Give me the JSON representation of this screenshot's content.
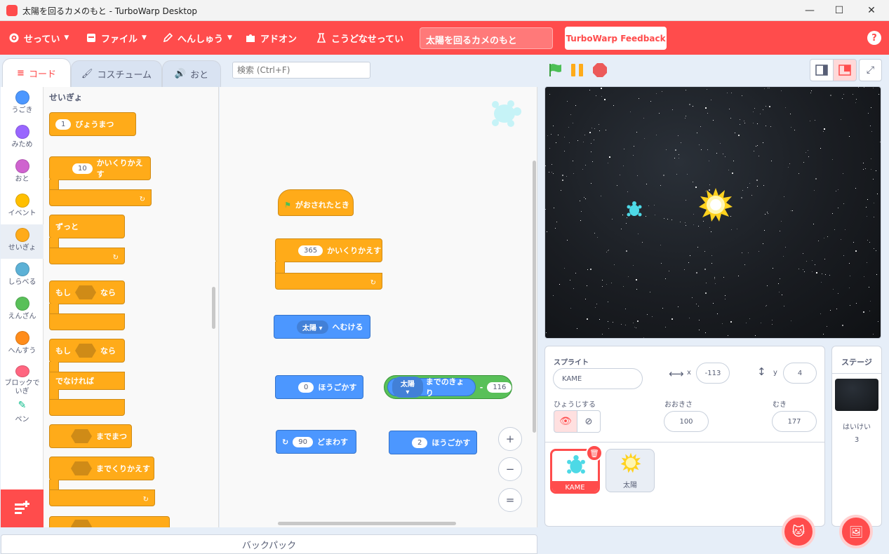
{
  "window": {
    "title": "太陽を回るカメのもと - TurboWarp Desktop",
    "minimize": "—",
    "maximize": "☐",
    "close": "✕"
  },
  "menu": {
    "settings": "せってい",
    "file": "ファイル",
    "edit": "へんしゅう",
    "addons": "アドオン",
    "howto": "こうどなせってい",
    "project_title": "太陽を回るカメのもと",
    "feedback": "TurboWarp Feedback",
    "help": "?"
  },
  "tabs": {
    "code": "コード",
    "costume": "コスチューム",
    "sound": "おと"
  },
  "search": {
    "placeholder": "検索 (Ctrl+F)"
  },
  "categories": [
    {
      "label": "うごき",
      "color": "#4c97ff"
    },
    {
      "label": "みため",
      "color": "#9966ff"
    },
    {
      "label": "おと",
      "color": "#cf63cf"
    },
    {
      "label": "イベント",
      "color": "#ffbf00"
    },
    {
      "label": "せいぎょ",
      "color": "#ffab19"
    },
    {
      "label": "しらべる",
      "color": "#5cb1d6"
    },
    {
      "label": "えんざん",
      "color": "#59c059"
    },
    {
      "label": "へんすう",
      "color": "#ff8c1a"
    },
    {
      "label": "ブロックでいぎ",
      "color": "#ff6680"
    },
    {
      "label": "ペン",
      "color": ""
    }
  ],
  "flyout": {
    "heading": "せいぎょ",
    "wait_value": "1",
    "wait_label": "びょうまつ",
    "repeat_value": "10",
    "repeat_label": "かいくりかえす",
    "forever_label": "ずっと",
    "if_label": "もし",
    "then_label": "なら",
    "if2_label": "もし",
    "then2_label": "なら",
    "else_label": "でなければ",
    "wait_until_label": "までまつ",
    "repeat_until_label": "までくりかえす"
  },
  "script": {
    "hat_label": "がおされたとき",
    "repeat_value": "365",
    "repeat_label": "かいくりかえす",
    "point_target": "太陽",
    "point_label": "へむける",
    "move_value": "0",
    "move_label": "ほうごかす",
    "distance_target": "太陽",
    "distance_label": "までのきょり",
    "minus": "-",
    "minus_value": "116",
    "turn_value": "90",
    "turn_label": "どまわす",
    "move2_value": "2",
    "move2_label": "ほうごかす"
  },
  "zoom": {
    "in": "+",
    "out": "−",
    "reset": "="
  },
  "backpack": "バックパック",
  "sprite_info": {
    "sprite_label": "スプライト",
    "sprite_name": "KAME",
    "x_label": "x",
    "x_value": "-113",
    "y_label": "y",
    "y_value": "4",
    "show_label": "ひょうじする",
    "size_label": "おおきさ",
    "size_value": "100",
    "direction_label": "むき",
    "direction_value": "177"
  },
  "sprites": [
    {
      "name": "KAME",
      "selected": true
    },
    {
      "name": "太陽",
      "selected": false
    }
  ],
  "stage_pane": {
    "title": "ステージ",
    "backdrops_label": "はいけい",
    "backdrops_count": "3"
  },
  "colors": {
    "accent": "#ff4c4c",
    "control": "#ffab19",
    "motion": "#4c97ff",
    "operators": "#59c059"
  }
}
